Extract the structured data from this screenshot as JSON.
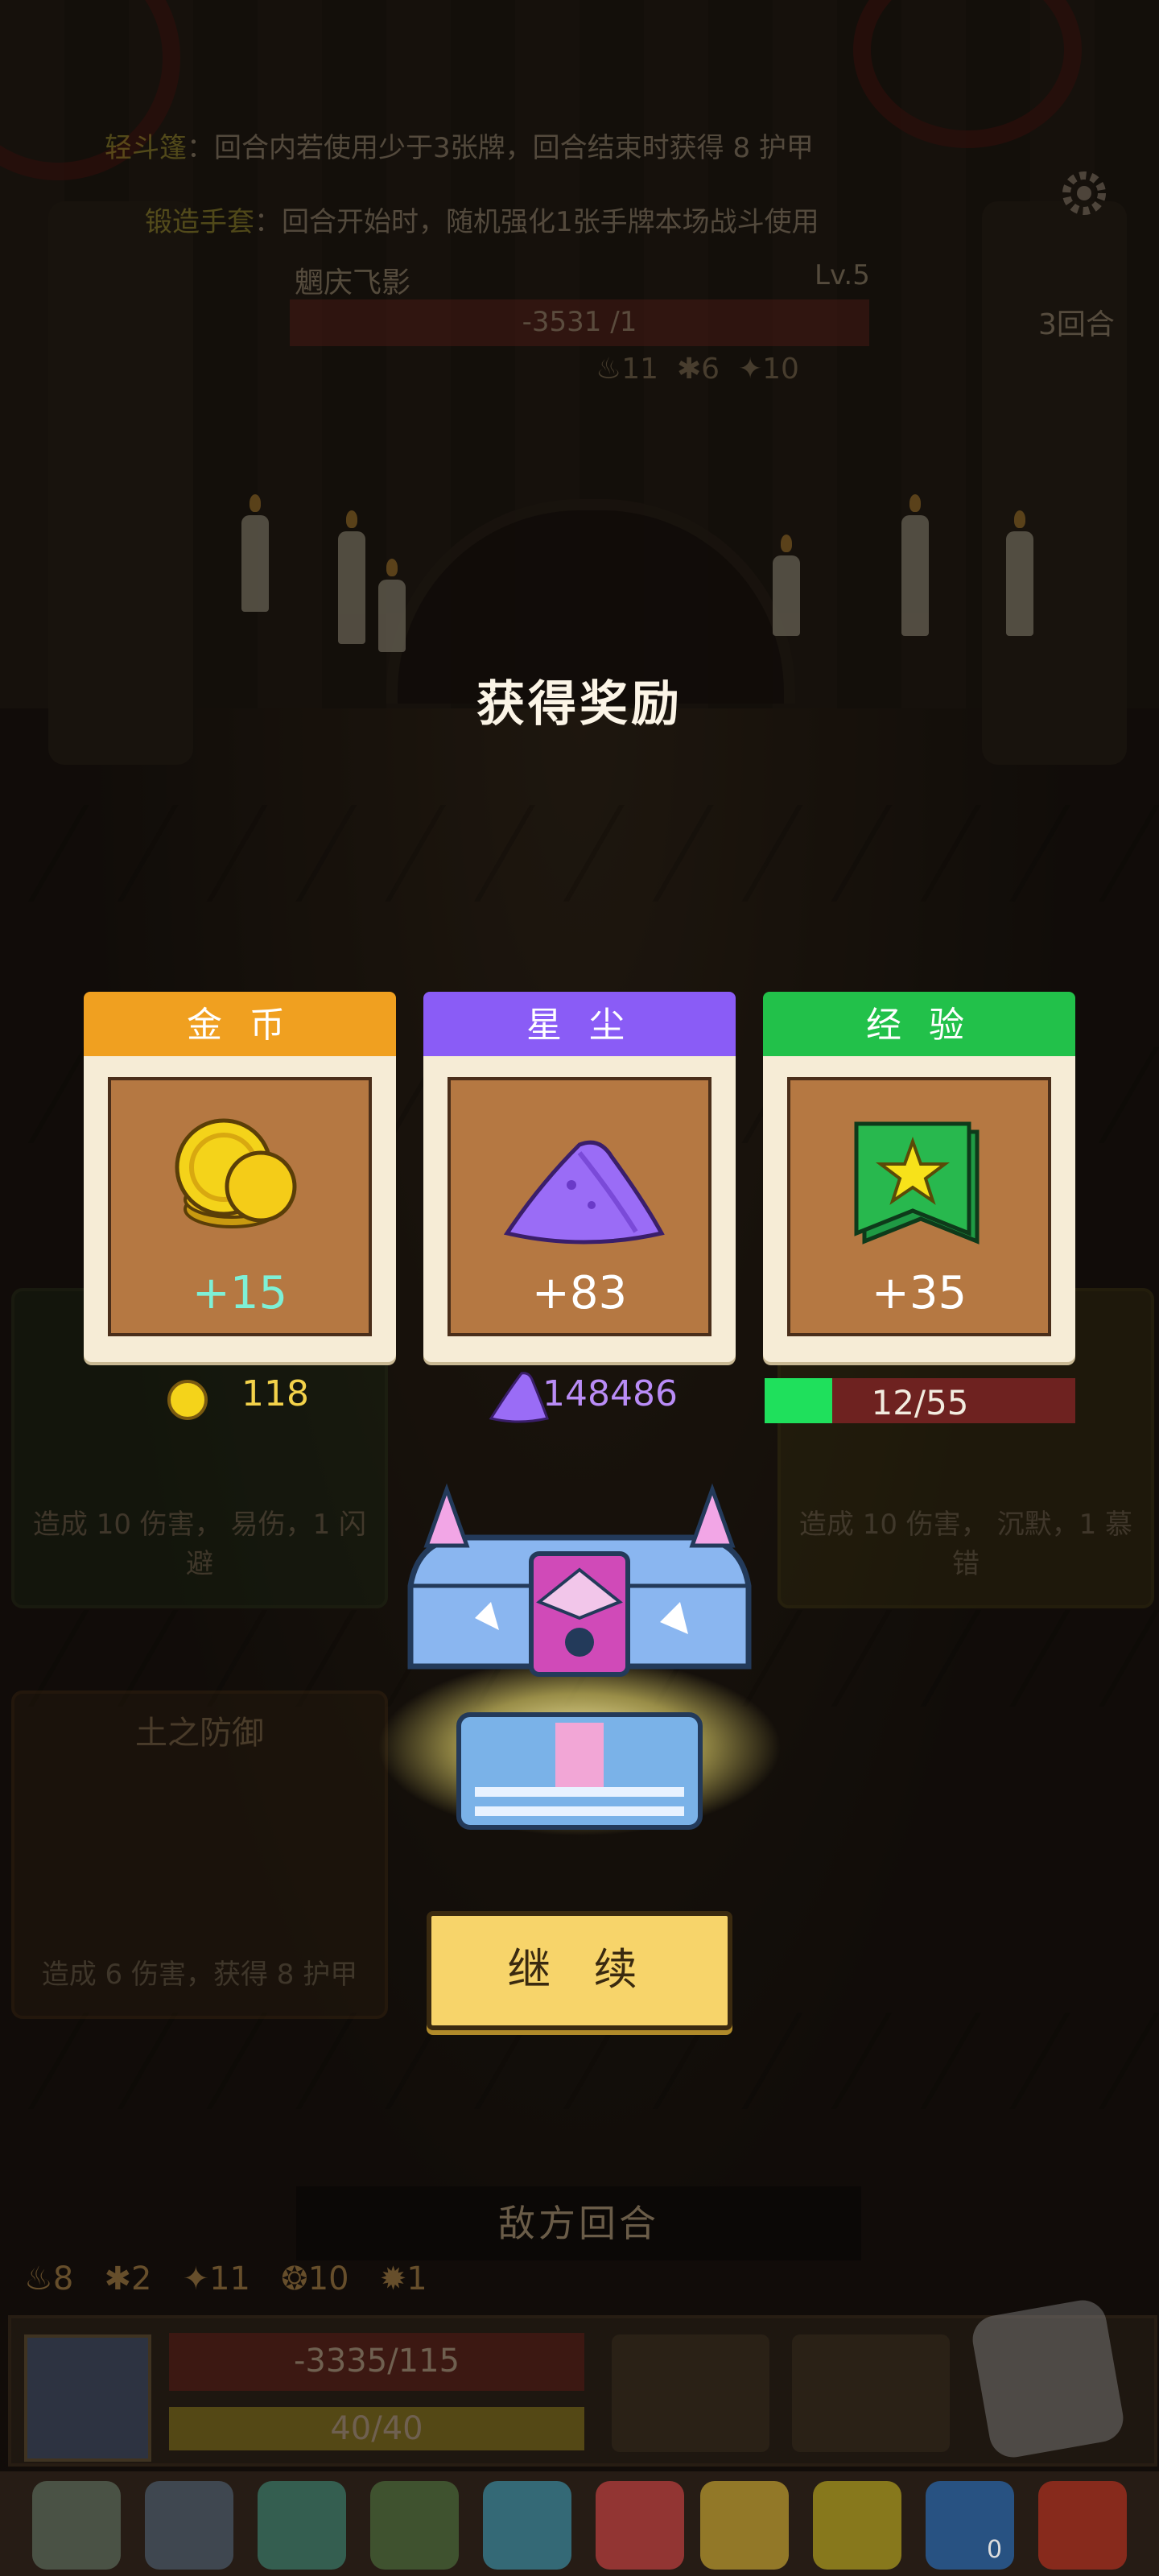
{
  "top_info": {
    "line1_key": "轻斗篷",
    "line1_text": "：回合内若使用少于3张牌，回合结束时获得",
    "line1_value": "8",
    "line1_suffix": "护甲",
    "line2_key": "锻造手套",
    "line2_text": "：回合开始时，随机强化1张手牌本场战斗使用"
  },
  "enemy": {
    "name": "魍庆飞影",
    "level": "Lv.5",
    "hp": "-3531 /1",
    "rounds": "3回合",
    "status_fire": "11",
    "status_purple": "6",
    "status_gold": "10"
  },
  "modal": {
    "title": "获得奖励",
    "rewards": [
      {
        "label": "金 币",
        "amount": "+15",
        "color": "#f0a020",
        "icon": "gold-coins-icon"
      },
      {
        "label": "星 尘",
        "amount": "+83",
        "color": "#8a5cf6",
        "icon": "stardust-icon"
      },
      {
        "label": "经 验",
        "amount": "+35",
        "color": "#22c14a",
        "icon": "xp-banner-icon"
      }
    ],
    "gold_total": "118",
    "stardust_total": "148486",
    "xp_text": "12/55",
    "xp_fraction": 0.218,
    "continue_label": "继 续"
  },
  "bottom": {
    "skill1_desc": "造成 10 伤害， 易伤，1 闪避",
    "skill2_desc": "造成 10 伤害， 沉默，1 慕错",
    "skill3_title": "土之防御",
    "skill3_desc": "造成 6 伤害，获得 8 护甲",
    "enemy_turn": "敌方回合",
    "player_stats": [
      "8",
      "2",
      "11",
      "10",
      "1"
    ],
    "player_hp": "-3335/115",
    "player_mp": "40/40",
    "item_badge": "0"
  },
  "colors": {
    "gold_tab": "#f0a020",
    "stardust_tab": "#8a5cf6",
    "xp_tab": "#22c14a",
    "xp_fill": "#1fe05c",
    "button": "#f7d46a"
  }
}
